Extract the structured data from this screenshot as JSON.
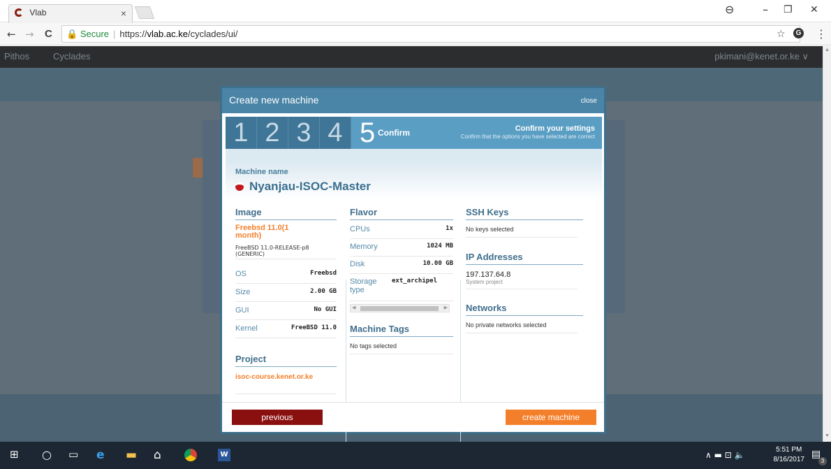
{
  "browser": {
    "tab_title": "Vlab",
    "tab_close": "×",
    "win_controls": {
      "account": "⊖",
      "minimize": "–",
      "maximize": "❐",
      "close": "✕"
    },
    "nav": {
      "back": "←",
      "forward": "→",
      "reload": "C"
    },
    "address": {
      "secure_label": "Secure",
      "separator": "|",
      "url_scheme": "https://",
      "url_host": "vlab.ac.ke",
      "url_path": "/cyclades/ui/"
    },
    "star": "☆",
    "menu": "⋮"
  },
  "app": {
    "nav_items": [
      "Pithos",
      "Cyclades"
    ],
    "user": "pkimani@kenet.or.ke ∨"
  },
  "modal": {
    "title": "Create new machine",
    "close": "close",
    "steps": [
      "1",
      "2",
      "3",
      "4"
    ],
    "current_step_number": "5",
    "current_step_label": "Confirm",
    "confirm_title": "Confirm your settings",
    "confirm_subtitle": "Confirm that the options you have selected are correct",
    "machine_name_label": "Machine name",
    "machine_name": "Nyanjau-ISOC-Master",
    "image": {
      "heading": "Image",
      "name": "Freebsd 11.0(1 month)",
      "description": "FreeBSD 11.0-RELEASE-p8 (GENERIC)",
      "rows": [
        {
          "k": "OS",
          "v": "Freebsd"
        },
        {
          "k": "Size",
          "v": "2.00 GB"
        },
        {
          "k": "GUI",
          "v": "No GUI"
        },
        {
          "k": "Kernel",
          "v": "FreeBSD 11.0"
        }
      ]
    },
    "project": {
      "heading": "Project",
      "value": "isoc-course.kenet.or.ke"
    },
    "flavor": {
      "heading": "Flavor",
      "rows": [
        {
          "k": "CPUs",
          "v": "1x"
        },
        {
          "k": "Memory",
          "v": "1024 MB"
        },
        {
          "k": "Disk",
          "v": "10.00 GB"
        },
        {
          "k": "Storage type",
          "v": "ext_archipel"
        }
      ]
    },
    "tags": {
      "heading": "Machine Tags",
      "value": "No tags selected"
    },
    "ssh": {
      "heading": "SSH Keys",
      "value": "No keys selected"
    },
    "ip": {
      "heading": "IP Addresses",
      "address": "197.137.64.8",
      "sub": "System project"
    },
    "networks": {
      "heading": "Networks",
      "value": "No private networks selected"
    },
    "previous_label": "previous",
    "create_label": "create machine"
  },
  "taskbar": {
    "time": "5:51 PM",
    "date": "8/16/2017",
    "tray": "∧ ▬ ⊡ 🔈",
    "notif_count": "3"
  },
  "colors": {
    "accent": "#4a84a6",
    "orange": "#f47f2a",
    "danger": "#8a0f0f"
  }
}
